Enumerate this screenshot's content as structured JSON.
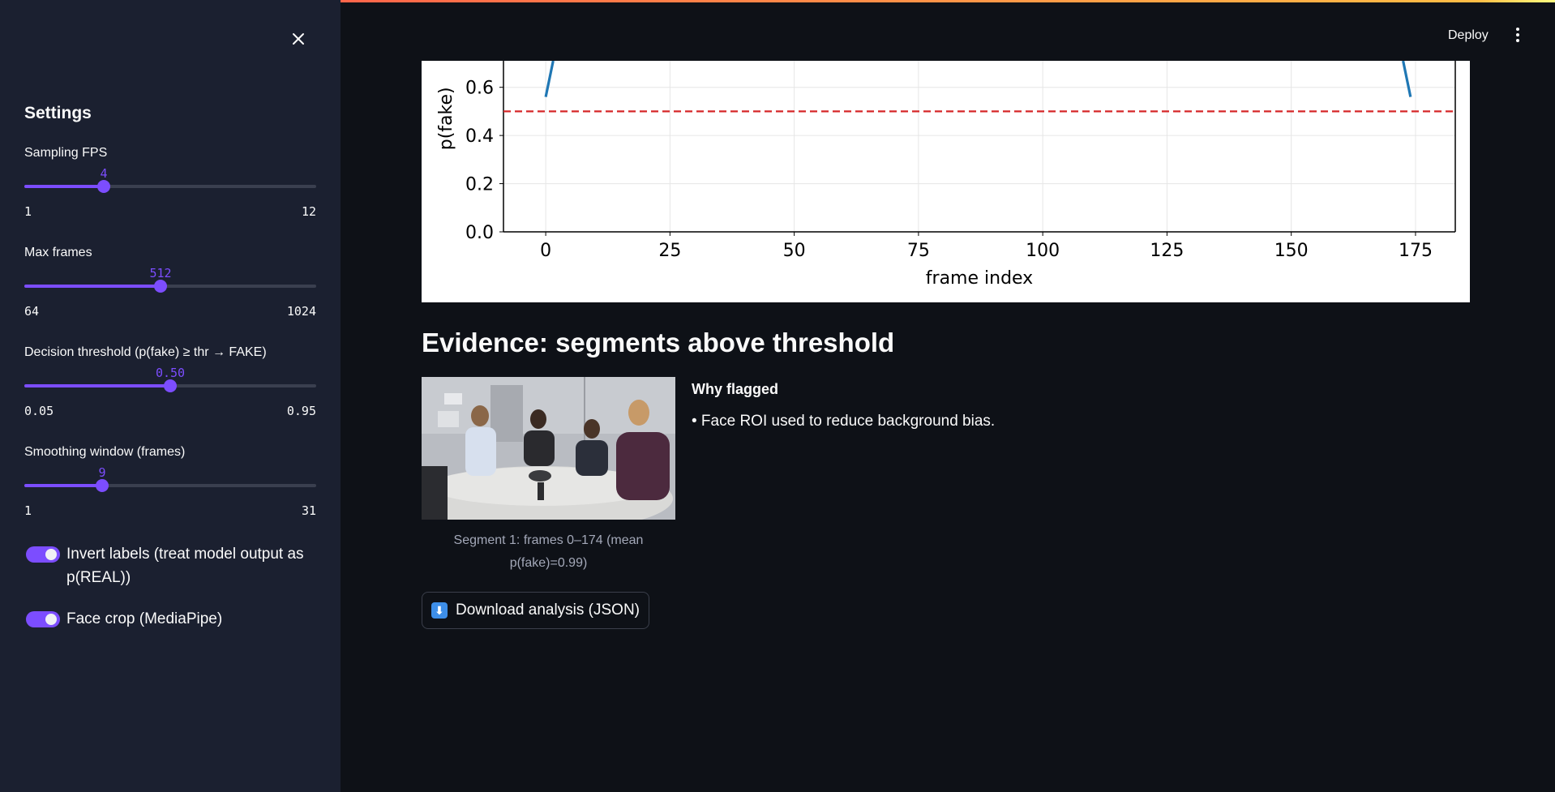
{
  "header": {
    "deploy_label": "Deploy"
  },
  "sidebar": {
    "title": "Settings",
    "sliders": [
      {
        "label": "Sampling FPS",
        "value": "4",
        "min": "1",
        "max": "12"
      },
      {
        "label": "Max frames",
        "value": "512",
        "min": "64",
        "max": "1024"
      },
      {
        "label": "Decision threshold (p(fake) ≥ thr → FAKE)",
        "value": "0.50",
        "min": "0.05",
        "max": "0.95"
      },
      {
        "label": "Smoothing window (frames)",
        "value": "9",
        "min": "1",
        "max": "31"
      }
    ],
    "toggles": [
      {
        "label": "Invert labels (treat model output as p(REAL))",
        "checked": true
      },
      {
        "label": "Face crop (MediaPipe)",
        "checked": true
      }
    ]
  },
  "chart_data": {
    "type": "line",
    "xlabel": "frame index",
    "ylabel": "p(fake)",
    "x_ticks": [
      "0",
      "25",
      "50",
      "75",
      "100",
      "125",
      "150",
      "175"
    ],
    "y_ticks": [
      "0.0",
      "0.2",
      "0.4",
      "0.6"
    ],
    "xlim": [
      -8.5,
      183
    ],
    "ylim_visible": [
      0,
      0.71
    ],
    "grid": true,
    "threshold": 0.5,
    "threshold_style": "red dashed",
    "series": [
      {
        "x": [
          0,
          1.5
        ],
        "y": [
          0.56,
          0.71
        ]
      },
      {
        "x": [
          172.5,
          174
        ],
        "y": [
          0.71,
          0.56
        ]
      }
    ]
  },
  "evidence": {
    "heading": "Evidence: segments above threshold",
    "caption": "Segment 1: frames 0–174 (mean p(fake)=0.99)",
    "why_title": "Why flagged",
    "why_items": [
      "• Face ROI used to reduce background bias."
    ]
  },
  "download": {
    "icon": "⬇",
    "label": "Download analysis (JSON)"
  },
  "colors": {
    "accent": "#7c4dff",
    "background": "#0e1117",
    "sidebar": "#1b2030",
    "series": "#1f77b4",
    "threshold": "#d62728"
  }
}
